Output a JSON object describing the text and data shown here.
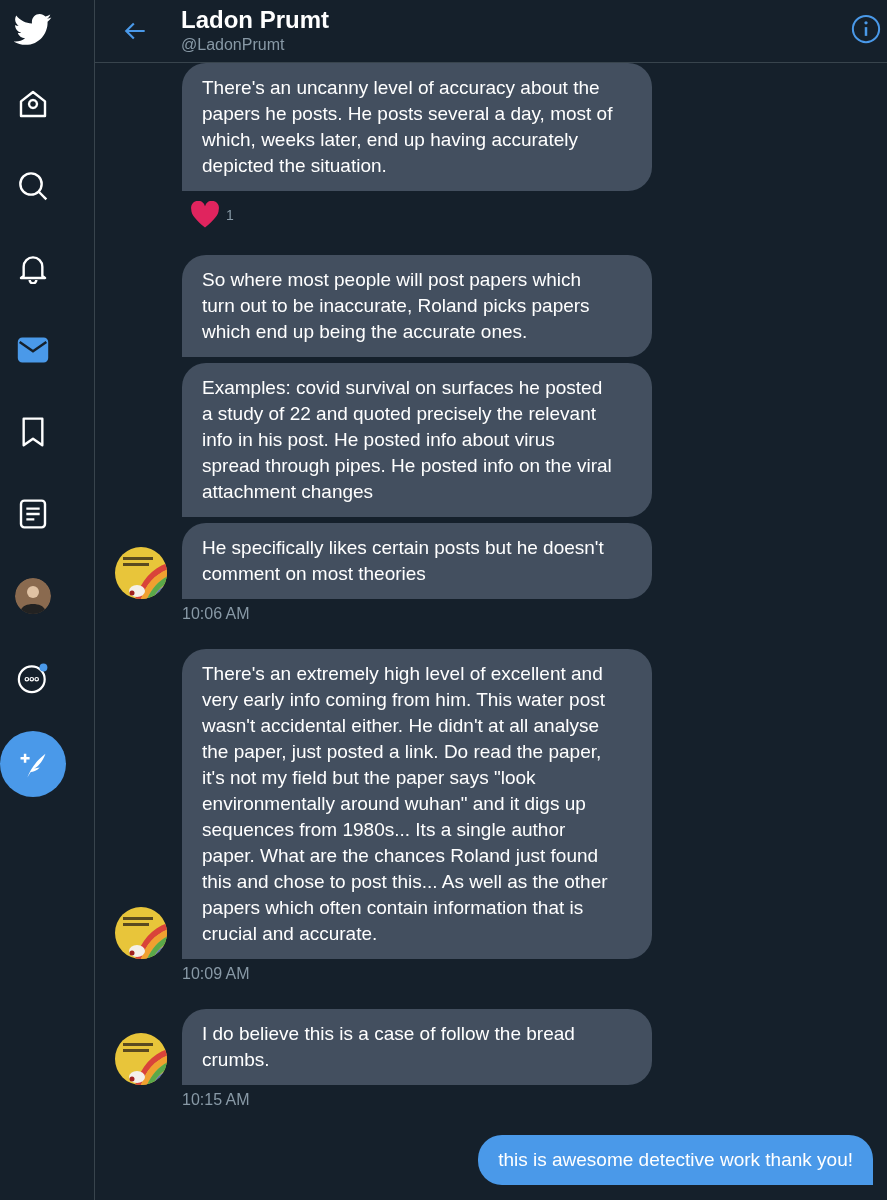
{
  "sidebar": {
    "items": [
      {
        "kind": "home",
        "selected": false
      },
      {
        "kind": "search",
        "selected": false
      },
      {
        "kind": "notifications",
        "selected": false
      },
      {
        "kind": "messages",
        "selected": true
      },
      {
        "kind": "bookmarks",
        "selected": false
      },
      {
        "kind": "lists",
        "selected": false
      },
      {
        "kind": "profile",
        "selected": false
      },
      {
        "kind": "more",
        "selected": false,
        "unread": true
      }
    ]
  },
  "header": {
    "name": "Ladon Prumt",
    "handle": "@LadonPrumt"
  },
  "messages": [
    {
      "kind": "incoming",
      "avatar": false,
      "text": "There's an uncanny level of accuracy about the papers he posts. He posts several a day, most of which, weeks later, end up having accurately depicted the situation."
    },
    {
      "kind": "reaction",
      "count": "1"
    },
    {
      "kind": "incoming",
      "avatar": false,
      "text": "So where most people will post papers which turn out to be inaccurate, Roland picks papers which end up being the accurate ones."
    },
    {
      "kind": "incoming",
      "avatar": false,
      "text": "Examples: covid survival on surfaces he posted a study of 22 and quoted precisely the relevant info in his post. He posted info about virus spread through pipes. He posted info on the viral attachment changes"
    },
    {
      "kind": "incoming",
      "avatar": true,
      "text": "He specifically likes certain posts but he doesn't comment on most theories"
    },
    {
      "kind": "timestamp",
      "text": "10:06 AM"
    },
    {
      "kind": "incoming",
      "avatar": true,
      "text": "There's an extremely high level of excellent and very early info coming from him. This water post wasn't accidental either. He didn't at all analyse the paper, just posted a link. Do read the paper, it's not my field but the paper says \"look environmentally around wuhan\" and it digs up sequences from 1980s... Its a single author paper. What are the chances Roland just found this and chose to post this... As well as the other papers which often contain information that is crucial and accurate."
    },
    {
      "kind": "timestamp",
      "text": "10:09 AM"
    },
    {
      "kind": "incoming",
      "avatar": true,
      "text": "I do believe this is a case of follow the bread crumbs."
    },
    {
      "kind": "timestamp",
      "text": "10:15 AM"
    },
    {
      "kind": "outgoing",
      "text": "this is awesome detective work thank you!"
    }
  ]
}
